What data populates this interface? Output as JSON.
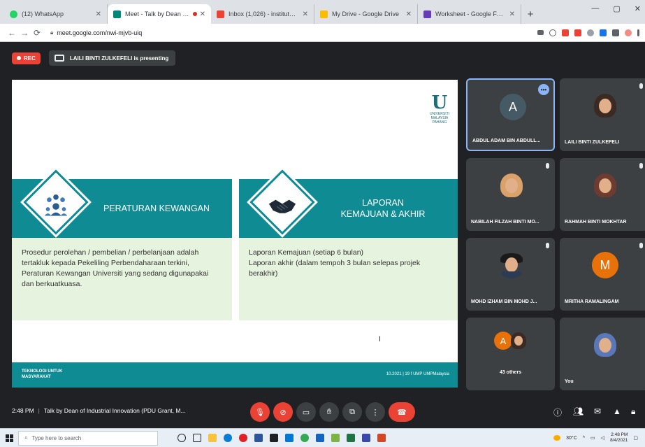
{
  "browser": {
    "tabs": [
      {
        "label": "(12) WhatsApp",
        "favicon_color": "#25d366",
        "active": false
      },
      {
        "label": "Meet - Talk by Dean of Ind...",
        "favicon_color": "#00897b",
        "active": true,
        "recording": true
      },
      {
        "label": "Inbox (1,026) - institut@ump...",
        "favicon_color": "#ea4335",
        "active": false
      },
      {
        "label": "My Drive - Google Drive",
        "favicon_color": "#fbbc04",
        "active": false
      },
      {
        "label": "Worksheet - Google Forms",
        "favicon_color": "#673ab7",
        "active": false
      }
    ],
    "new_tab": "+",
    "url": "meet.google.com/nwi-mjvb-uiq",
    "window_controls": {
      "minimize": "—",
      "maximize": "▢",
      "close": "✕"
    }
  },
  "meet": {
    "rec_label": "REC",
    "presenter_text": "LAILI BINTI ZULKEFELI is presenting",
    "slide": {
      "logo_mark": "U",
      "logo_sub": "UNIVERSITI MALAYSIA PAHANG",
      "left_title": "PERATURAN KEWANGAN",
      "right_title_line1": "LAPORAN",
      "right_title_line2": "KEMAJUAN & AKHIR",
      "left_text": "Prosedur perolehan / pembelian / perbelanjaan adalah tertakluk kepada Pekeliling Perbendaharaan terkini, Peraturan Kewangan Universiti yang sedang digunapakai dan berkuatkuasa.",
      "right_text_line1": "Laporan Kemajuan (setiap 6 bulan)",
      "right_text_line2": "Laporan akhir (dalam tempoh 3 bulan selepas projek berakhir)",
      "footer_left_line1": "TEKNOLOGI UNTUK",
      "footer_left_line2": "MASYARAKAT",
      "footer_right": "10.2021 | 19  f UMP  UMPMalaysia",
      "cursor": "I"
    },
    "participants": [
      {
        "name": "ABDUL ADAM BIN ABDULL...",
        "initial": "A",
        "avatar_color": "#455a64",
        "type": "letter",
        "active": true
      },
      {
        "name": "LAILI BINTI ZULKEFELI",
        "type": "photo",
        "hijab_color": "#3b2a24"
      },
      {
        "name": "NABILAH FILZAH BINTI MO...",
        "type": "photo",
        "hijab_color": "#d9a26a"
      },
      {
        "name": "RAHMAH BINTI MOKHTAR",
        "type": "photo",
        "hijab_color": "#6d3b2f"
      },
      {
        "name": "MOHD IZHAM BIN MOHD J...",
        "type": "photo",
        "hijab_color": "#1a1a1a"
      },
      {
        "name": "MRITHA RAMALINGAM",
        "initial": "M",
        "avatar_color": "#e8710a",
        "type": "letter"
      },
      {
        "name": "43 others",
        "initial": "A",
        "avatar_color": "#e8710a",
        "type": "others"
      },
      {
        "name": "You",
        "type": "photo",
        "hijab_color": "#5a78b8"
      }
    ],
    "more_options": "•••",
    "time": "2:48 PM",
    "meeting_title": "Talk by Dean of Industrial Innovation (PDU Grant, M...",
    "controls": {
      "end_call": "☎"
    }
  },
  "taskbar": {
    "search_placeholder": "Type here to search",
    "weather": "30°C",
    "clock_time": "2:48 PM",
    "clock_date": "8/4/2021"
  }
}
